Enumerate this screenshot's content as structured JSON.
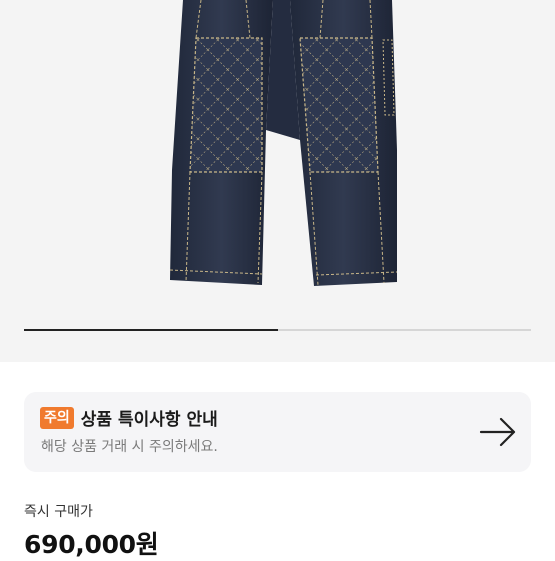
{
  "gallery": {
    "progress_fraction": 0.5
  },
  "notice": {
    "badge": "주의",
    "title": "상품 특이사항 안내",
    "subtitle": "해당 상품 거래 시 주의하세요.",
    "icon": "arrow-right-icon"
  },
  "price": {
    "label": "즉시 구매가",
    "value": "690,000원"
  },
  "colors": {
    "badge": "#f07a2e",
    "card_bg": "#f5f5f7",
    "gallery_bg": "#f4f4f4",
    "denim": "#2b3347",
    "stitch": "#c9b789"
  }
}
